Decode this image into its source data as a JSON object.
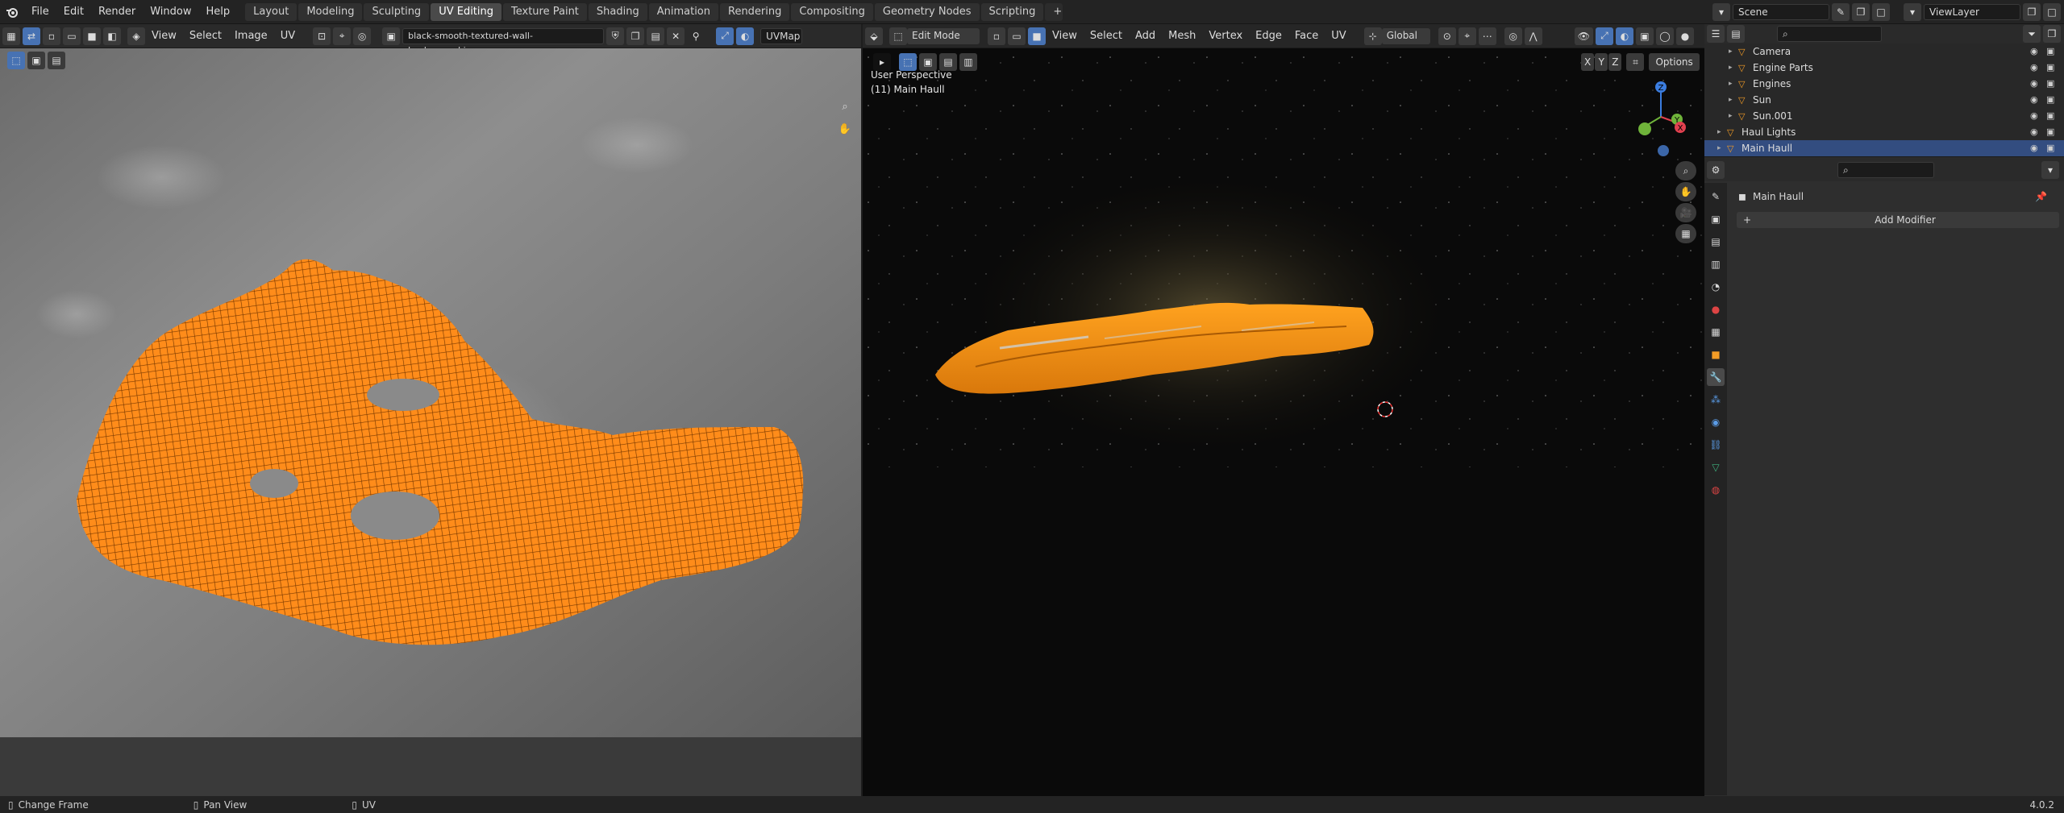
{
  "topbar": {
    "menus": [
      "File",
      "Edit",
      "Render",
      "Window",
      "Help"
    ],
    "workspaces": [
      "Layout",
      "Modeling",
      "Sculpting",
      "UV Editing",
      "Texture Paint",
      "Shading",
      "Animation",
      "Rendering",
      "Compositing",
      "Geometry Nodes",
      "Scripting"
    ],
    "active_workspace": "UV Editing",
    "add_tab": "+",
    "scene": "Scene",
    "view_layer": "ViewLayer"
  },
  "uv_editor": {
    "menus": [
      "View",
      "Select",
      "Image",
      "UV"
    ],
    "image_name": "black-smooth-textured-wall-background.jpg",
    "uv_map": "UVMap"
  },
  "viewport": {
    "mode": "Edit Mode",
    "menus": [
      "View",
      "Select",
      "Add",
      "Mesh",
      "Vertex",
      "Edge",
      "Face",
      "UV"
    ],
    "transform_orientation": "Global",
    "perspective_label": "User Perspective",
    "object_label": "(11) Main Haull",
    "axis_buttons": [
      "X",
      "Y",
      "Z"
    ],
    "options_label": "Options",
    "gizmo_axes": [
      "Z",
      "Y",
      "X"
    ]
  },
  "outliner": {
    "items": [
      {
        "name": "Camera",
        "indent": 2
      },
      {
        "name": "Engine Parts",
        "indent": 2
      },
      {
        "name": "Engines",
        "indent": 2
      },
      {
        "name": "Sun",
        "indent": 2
      },
      {
        "name": "Sun.001",
        "indent": 2
      },
      {
        "name": "Haul Lights",
        "indent": 1
      },
      {
        "name": "Main Haull",
        "indent": 1
      }
    ],
    "selected": "Main Haull"
  },
  "properties": {
    "object_name": "Main Haull",
    "add_modifier_label": "Add Modifier"
  },
  "statusbar": {
    "items": [
      "Change Frame",
      "Pan View",
      "UV"
    ],
    "version": "4.0.2"
  },
  "colors": {
    "accent": "#4772b3",
    "uv_orange": "#ff8c1a",
    "selection": "#334d80"
  }
}
